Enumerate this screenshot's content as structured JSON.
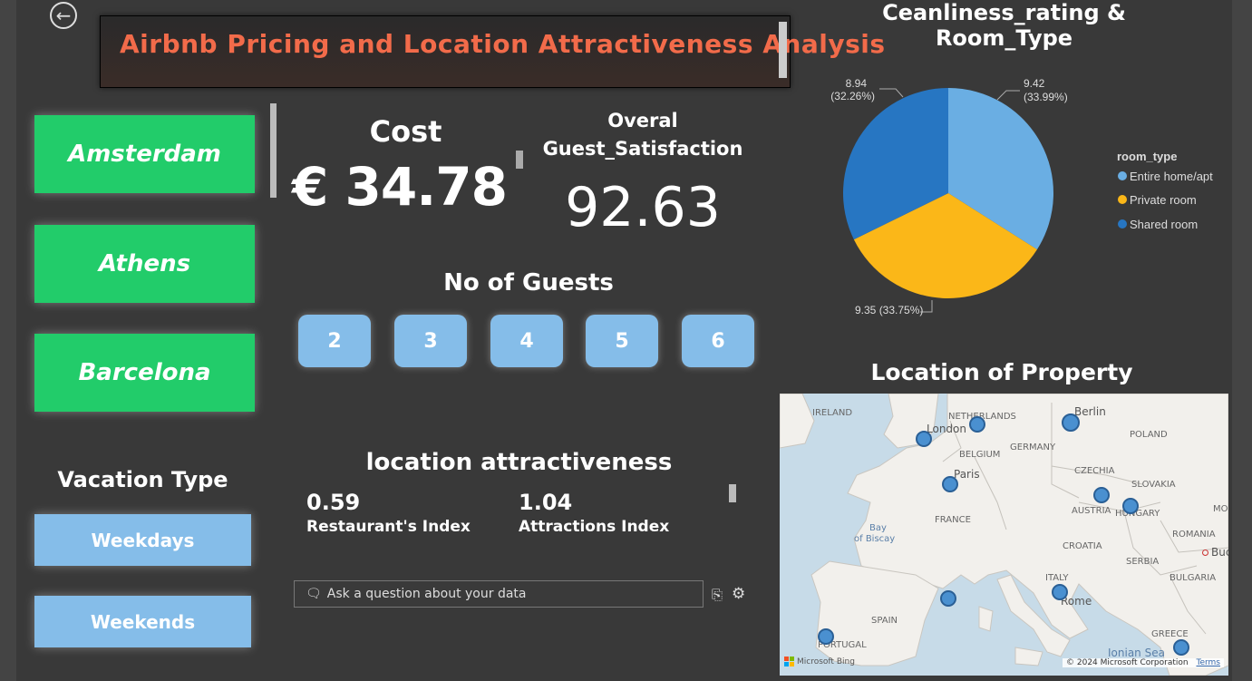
{
  "header": {
    "title": "Airbnb Pricing and Location Attractiveness Analysis",
    "back_icon": "back-arrow-icon"
  },
  "cities": [
    "Amsterdam",
    "Athens",
    "Barcelona"
  ],
  "kpis": {
    "cost_label": "Cost",
    "cost_value": "€ 34.78",
    "satisfaction_label_line1": "Overal",
    "satisfaction_label_line2": "Guest_Satisfaction",
    "satisfaction_value": "92.63"
  },
  "guests": {
    "title": "No of Guests",
    "options": [
      "2",
      "3",
      "4",
      "5",
      "6"
    ]
  },
  "vacation": {
    "title": "Vacation Type",
    "options": [
      "Weekdays",
      "Weekends"
    ]
  },
  "location": {
    "title": "location attractiveness",
    "restaurant_value": "0.59",
    "restaurant_label": "Restaurant's Index",
    "attractions_value": "1.04",
    "attractions_label": "Attractions Index"
  },
  "qa": {
    "placeholder": "Ask a question about your data"
  },
  "chart_data": {
    "type": "pie",
    "title": "Ceanliness_rating & Room_Type",
    "legend_title": "room_type",
    "legend_position": "right",
    "slices": [
      {
        "name": "Entire home/apt",
        "value": 9.42,
        "percent": "33.99%",
        "color": "#6aaee3",
        "label": "9.42",
        "label2": "(33.99%)"
      },
      {
        "name": "Private room",
        "value": 9.35,
        "percent": "33.75%",
        "color": "#fbb718",
        "label": "9.35 (33.75%)"
      },
      {
        "name": "Shared room",
        "value": 8.94,
        "percent": "32.26%",
        "color": "#2776c2",
        "label": "8.94",
        "label2": "(32.26%)"
      }
    ]
  },
  "map": {
    "title": "Location of Property",
    "labels": {
      "ireland": "IRELAND",
      "netherlands": "NETHERLANDS",
      "london": "London",
      "berlin": "Berlin",
      "poland": "POLAND",
      "belgium": "BELGIUM",
      "germany": "GERMANY",
      "paris": "Paris",
      "czechia": "CZECHIA",
      "slovakia": "SLOVAKIA",
      "austria": "AUSTRIA",
      "hungary": "HUNGARY",
      "mol": "MOL",
      "france": "FRANCE",
      "bay": "Bay",
      "of_biscay": "of Biscay",
      "romania": "ROMANIA",
      "buc": "Buc",
      "croatia": "CROATIA",
      "serbia": "SERBIA",
      "italy": "ITALY",
      "bulgaria": "BULGARIA",
      "rome": "Rome",
      "spain": "SPAIN",
      "portugal": "PORTUGAL",
      "greece": "GREECE",
      "ionian_sea": "Ionian Sea",
      "bing": "Microsoft Bing",
      "copyright": "© 2024 Microsoft Corporation",
      "terms": "Terms"
    }
  }
}
